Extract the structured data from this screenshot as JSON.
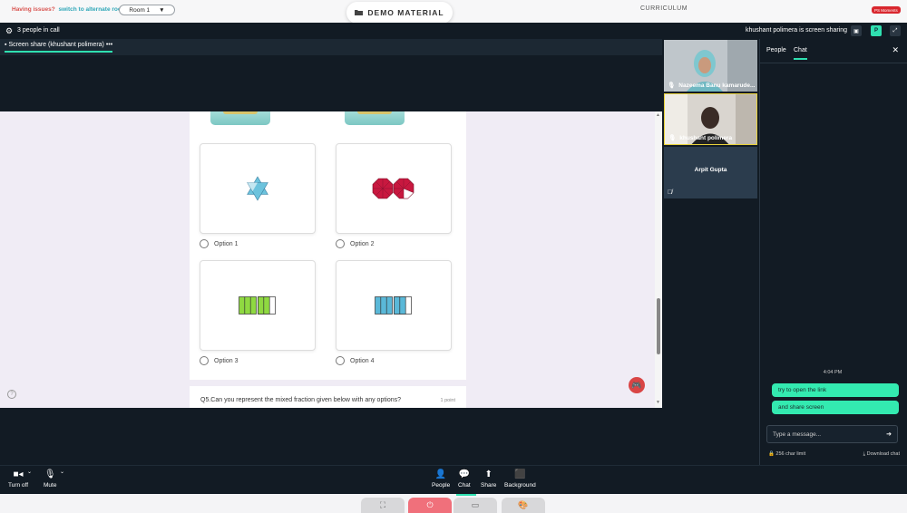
{
  "topbar": {
    "issues_text": "Having issues?",
    "alt_room_text": "switch to alternate room",
    "room_select": "Room 1",
    "demo_material": "DEMO MATERIAL",
    "curriculum": "CURRICULUM",
    "moments": "PS Moments"
  },
  "call_header": {
    "people_count": "3 people in call",
    "sharing_text": "khushant polimera is screen sharing",
    "avatar_letter": "P"
  },
  "screen_tab": "Screen share (khushant polimera)",
  "quiz": {
    "options": [
      {
        "label": "Option 1"
      },
      {
        "label": "Option 2"
      },
      {
        "label": "Option 3"
      },
      {
        "label": "Option 4"
      }
    ],
    "question": "Q5.Can you represent the mixed fraction given below with any options?",
    "points": "1 point"
  },
  "participants": [
    {
      "name": "Nazeema Banu kamarude..."
    },
    {
      "name": "khushant polimera"
    },
    {
      "name": "Arpit Gupta"
    }
  ],
  "chat": {
    "tab_people": "People",
    "tab_chat": "Chat",
    "time": "4:04 PM",
    "messages": [
      "try to open the link",
      "and share screen"
    ],
    "input_placeholder": "Type a message...",
    "char_limit": "256 char limit",
    "download": "Download chat"
  },
  "controls": {
    "turn_off": "Turn off",
    "mute": "Mute",
    "people": "People",
    "chat": "Chat",
    "share": "Share",
    "background": "Background"
  },
  "colors": {
    "accent": "#2fe0b0",
    "dark_bg": "#121b24",
    "bubble": "#33eab0",
    "star": "#6cc3dd",
    "octagon": "#c8183f",
    "green_bar": "#8fd941",
    "blue_bar": "#5ab8d8"
  }
}
